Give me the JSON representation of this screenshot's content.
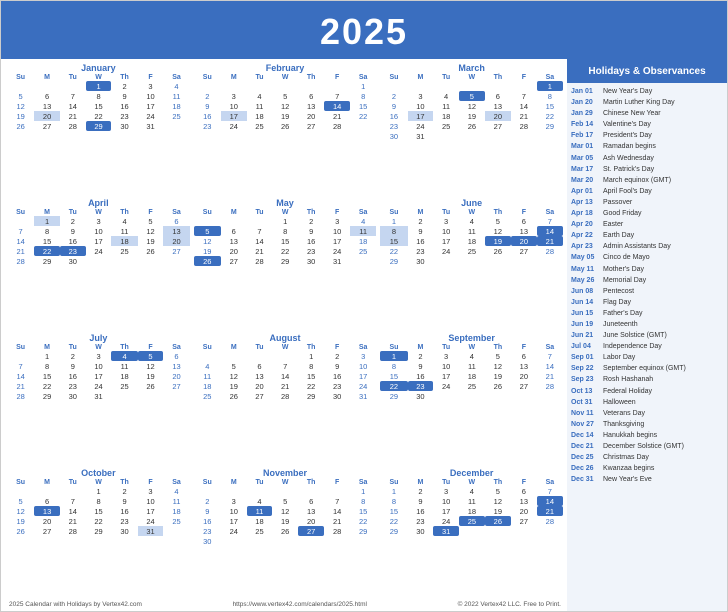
{
  "header": {
    "year": "2025",
    "title": "Holidays & Observances"
  },
  "months": [
    {
      "name": "January",
      "offset": 3,
      "days": 31,
      "highlighted": [
        1
      ],
      "holiday_days": [
        20
      ]
    },
    {
      "name": "February",
      "offset": 6,
      "days": 28,
      "highlighted": [
        14
      ],
      "holiday_days": [
        17
      ]
    },
    {
      "name": "March",
      "offset": 6,
      "days": 31,
      "highlighted": [
        1
      ],
      "holiday_days": [
        5,
        17,
        20
      ]
    },
    {
      "name": "April",
      "offset": 1,
      "days": 30,
      "highlighted": [],
      "holiday_days": [
        1,
        13,
        18,
        20,
        22
      ]
    },
    {
      "name": "May",
      "offset": 3,
      "days": 31,
      "highlighted": [],
      "holiday_days": [
        5,
        11,
        26
      ]
    },
    {
      "name": "June",
      "offset": 0,
      "days": 30,
      "highlighted": [
        14
      ],
      "holiday_days": [
        8,
        15,
        19,
        20
      ]
    },
    {
      "name": "July",
      "offset": 1,
      "days": 31,
      "highlighted": [
        4,
        5
      ],
      "holiday_days": [
        4
      ]
    },
    {
      "name": "August",
      "offset": 4,
      "days": 31,
      "highlighted": [],
      "holiday_days": []
    },
    {
      "name": "September",
      "offset": 0,
      "days": 30,
      "highlighted": [
        1
      ],
      "holiday_days": [
        1,
        22,
        23
      ]
    },
    {
      "name": "October",
      "offset": 3,
      "days": 31,
      "highlighted": [
        13
      ],
      "holiday_days": [
        13,
        31
      ]
    },
    {
      "name": "November",
      "offset": 6,
      "days": 30,
      "highlighted": [],
      "holiday_days": [
        11,
        27
      ]
    },
    {
      "name": "December",
      "offset": 0,
      "days": 31,
      "highlighted": [],
      "holiday_days": [
        14,
        21,
        25,
        26
      ]
    }
  ],
  "holidays": [
    {
      "date": "Jan 01",
      "name": "New Year's Day"
    },
    {
      "date": "Jan 20",
      "name": "Martin Luther King Day"
    },
    {
      "date": "Jan 29",
      "name": "Chinese New Year"
    },
    {
      "date": "Feb 14",
      "name": "Valentine's Day"
    },
    {
      "date": "Feb 17",
      "name": "President's Day"
    },
    {
      "date": "Mar 01",
      "name": "Ramadan begins"
    },
    {
      "date": "Mar 05",
      "name": "Ash Wednesday"
    },
    {
      "date": "Mar 17",
      "name": "St. Patrick's Day"
    },
    {
      "date": "Mar 20",
      "name": "March equinox (GMT)"
    },
    {
      "date": "Apr 01",
      "name": "April Fool's Day"
    },
    {
      "date": "Apr 13",
      "name": "Passover"
    },
    {
      "date": "Apr 18",
      "name": "Good Friday"
    },
    {
      "date": "Apr 20",
      "name": "Easter"
    },
    {
      "date": "Apr 22",
      "name": "Earth Day"
    },
    {
      "date": "Apr 23",
      "name": "Admin Assistants Day"
    },
    {
      "date": "May 05",
      "name": "Cinco de Mayo"
    },
    {
      "date": "May 11",
      "name": "Mother's Day"
    },
    {
      "date": "May 26",
      "name": "Memorial Day"
    },
    {
      "date": "Jun 08",
      "name": "Pentecost"
    },
    {
      "date": "Jun 14",
      "name": "Flag Day"
    },
    {
      "date": "Jun 15",
      "name": "Father's Day"
    },
    {
      "date": "Jun 19",
      "name": "Juneteenth"
    },
    {
      "date": "Jun 21",
      "name": "June Solstice (GMT)"
    },
    {
      "date": "Jul 04",
      "name": "Independence Day"
    },
    {
      "date": "Sep 01",
      "name": "Labor Day"
    },
    {
      "date": "Sep 22",
      "name": "September equinox (GMT)"
    },
    {
      "date": "Sep 23",
      "name": "Rosh Hashanah"
    },
    {
      "date": "Oct 13",
      "name": "Federal Holiday"
    },
    {
      "date": "Oct 31",
      "name": "Halloween"
    },
    {
      "date": "Nov 11",
      "name": "Veterans Day"
    },
    {
      "date": "Nov 27",
      "name": "Thanksgiving"
    },
    {
      "date": "Dec 14",
      "name": "Hanukkah begins"
    },
    {
      "date": "Dec 21",
      "name": "December Solstice (GMT)"
    },
    {
      "date": "Dec 25",
      "name": "Christmas Day"
    },
    {
      "date": "Dec 26",
      "name": "Kwanzaa begins"
    },
    {
      "date": "Dec 31",
      "name": "New Year's Eve"
    }
  ],
  "footer": {
    "left": "2025 Calendar with Holidays by Vertex42.com",
    "center": "https://www.vertex42.com/calendars/2025.html",
    "right": "© 2022 Vertex42 LLC. Free to Print."
  }
}
